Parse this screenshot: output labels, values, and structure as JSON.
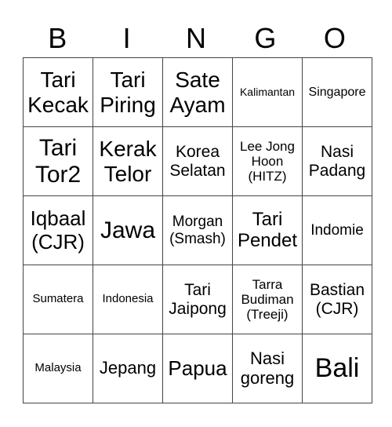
{
  "header": [
    "B",
    "I",
    "N",
    "G",
    "O"
  ],
  "rows": [
    [
      "Tari Kecak",
      "Tari Piring",
      "Sate Ayam",
      "Kalimantan",
      "Singapore"
    ],
    [
      "Tari Tor2",
      "Kerak Telor",
      "Korea Selatan",
      "Lee Jong Hoon (HITZ)",
      "Nasi Padang"
    ],
    [
      "Iqbaal (CJR)",
      "Jawa",
      "Morgan (Smash)",
      "Tari Pendet",
      "Indomie"
    ],
    [
      "Sumatera",
      "Indonesia",
      "Tari Jaipong",
      "Tarra Budiman (Treeji)",
      "Bastian (CJR)"
    ],
    [
      "Malaysia",
      "Jepang",
      "Papua",
      "Nasi goreng",
      "Bali"
    ]
  ]
}
